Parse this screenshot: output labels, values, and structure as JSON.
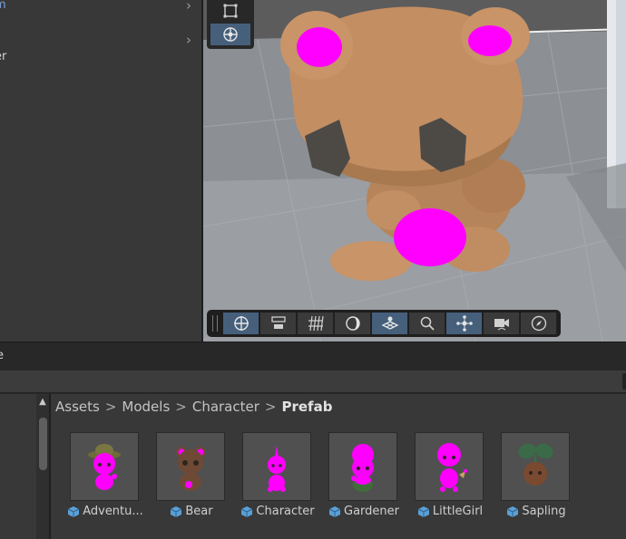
{
  "hierarchy": {
    "rows": [
      {
        "label": "m",
        "color": "#7ca0d8",
        "chevron": "chevron-right-icon"
      },
      {
        "label": "",
        "color": "#d2d2d2",
        "chevron": "chevron-right-icon"
      },
      {
        "label": "er",
        "color": "#d2d2d2",
        "chevron": ""
      }
    ]
  },
  "scene": {
    "tools": [
      "rect-tool-icon",
      "transform-tool-icon"
    ],
    "view_toolbar": [
      "move-gizmo-icon",
      "align-toggle-icon",
      "grid-snap-icon",
      "shading-mode-icon",
      "grid-plane-icon",
      "search-zoom-icon",
      "orientation-gizmo-icon",
      "camera-icon",
      "compass-icon"
    ]
  },
  "project": {
    "tab_label": "e",
    "breadcrumb": [
      "Assets",
      "Models",
      "Character"
    ],
    "breadcrumb_current": "Prefab",
    "assets": [
      {
        "name": "Adventu...",
        "icon": "prefab-icon"
      },
      {
        "name": "Bear",
        "icon": "prefab-icon"
      },
      {
        "name": "Character",
        "icon": "prefab-icon"
      },
      {
        "name": "Gardener",
        "icon": "prefab-icon"
      },
      {
        "name": "LittleGirl",
        "icon": "prefab-icon"
      },
      {
        "name": "Sapling",
        "icon": "prefab-icon"
      }
    ]
  },
  "colors": {
    "accent": "#46607c",
    "missing_material": "#ff00ff",
    "bear_brown": "#c89468"
  }
}
